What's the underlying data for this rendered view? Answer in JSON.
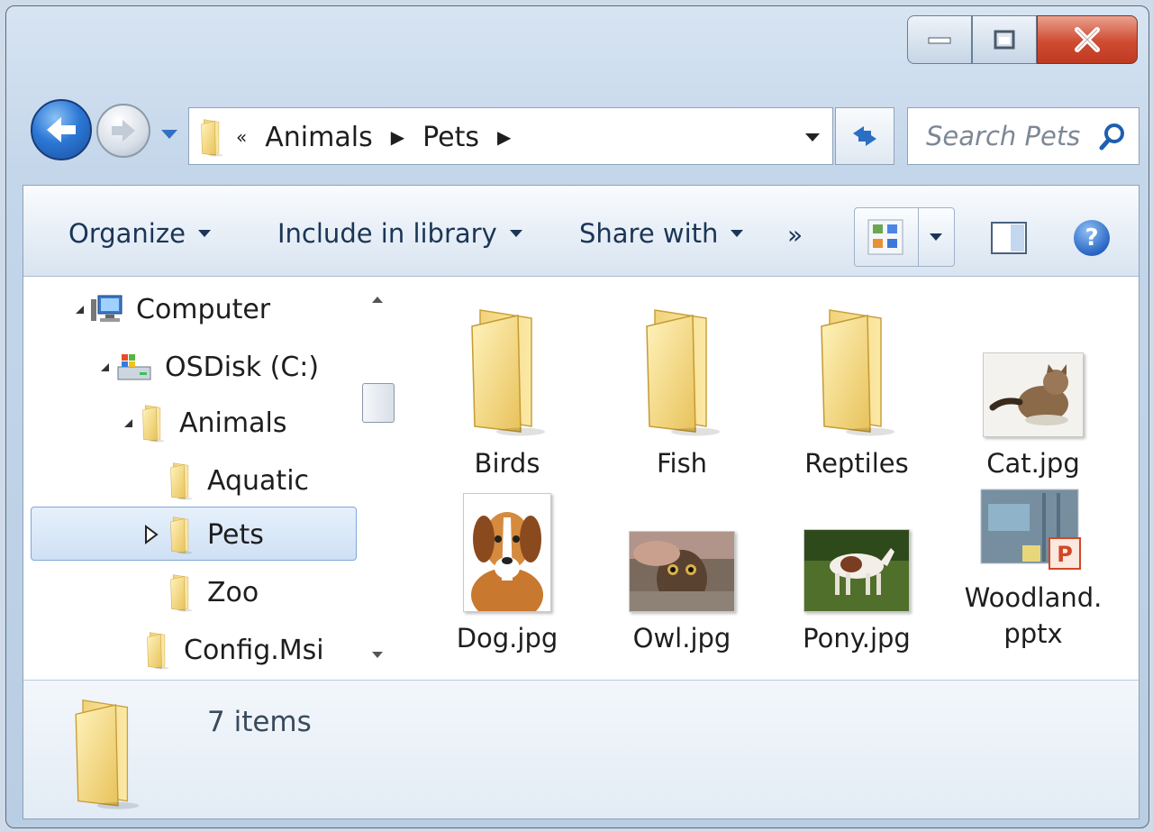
{
  "window": {
    "caption_buttons": {
      "minimize_icon": "minimize-icon",
      "maximize_icon": "maximize-icon",
      "close_icon": "close-icon"
    }
  },
  "nav": {
    "address": {
      "overflow": "«",
      "crumbs": [
        "Animals",
        "Pets"
      ]
    },
    "search_placeholder": "Search Pets"
  },
  "toolbar": {
    "organize": "Organize",
    "include_in_library": "Include in library",
    "share_with": "Share with",
    "more": "»"
  },
  "tree": [
    {
      "label": "Computer",
      "icon": "computer-icon",
      "expanded": true
    },
    {
      "label": "OSDisk (C:)",
      "icon": "drive-icon",
      "expanded": true
    },
    {
      "label": "Animals",
      "icon": "folder-icon",
      "expanded": true
    },
    {
      "label": "Aquatic",
      "icon": "folder-icon"
    },
    {
      "label": "Pets",
      "icon": "folder-icon",
      "selected": true
    },
    {
      "label": "Zoo",
      "icon": "folder-icon"
    },
    {
      "label": "Config.Msi",
      "icon": "folder-icon"
    }
  ],
  "files": [
    {
      "name": "Birds",
      "type": "folder"
    },
    {
      "name": "Fish",
      "type": "folder"
    },
    {
      "name": "Reptiles",
      "type": "folder"
    },
    {
      "name": "Cat.jpg",
      "type": "image"
    },
    {
      "name": "Dog.jpg",
      "type": "image"
    },
    {
      "name": "Owl.jpg",
      "type": "image"
    },
    {
      "name": "Pony.jpg",
      "type": "image"
    },
    {
      "name": "Woodland.pptx",
      "name_line1": "Woodland.",
      "name_line2": "pptx",
      "type": "powerpoint"
    }
  ],
  "details": {
    "count": "7 items"
  },
  "colors": {
    "accent": "#2c78d6",
    "selection": "#cfe1f5",
    "close": "#cf4b32"
  }
}
